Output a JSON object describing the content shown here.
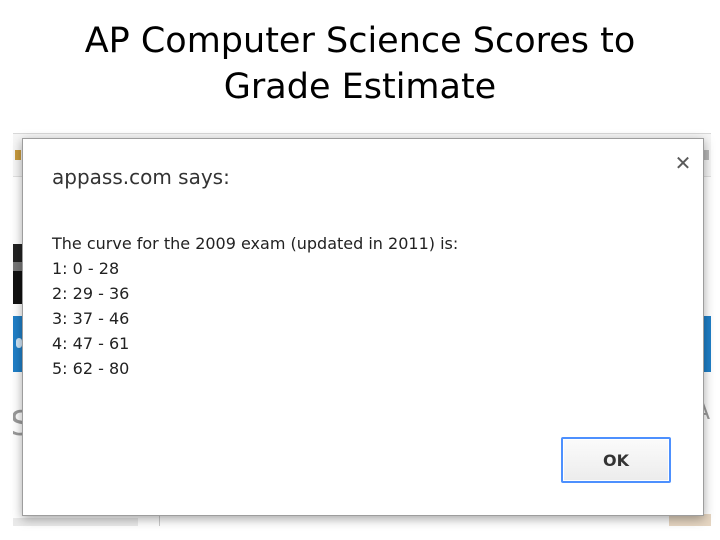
{
  "slide": {
    "title_line1": "AP Computer Science Scores to",
    "title_line2": "Grade Estimate"
  },
  "dialog": {
    "title": "appass.com says:",
    "close_icon": "close-icon",
    "message_lines": [
      "The curve for the 2009 exam (updated in 2011) is:",
      "1: 0 - 28",
      "2: 29 - 36",
      "3: 37 - 46",
      "4: 47 - 61",
      "5: 62 - 80"
    ],
    "ok_label": "OK",
    "focus_color": "#4d90fe"
  },
  "background": {
    "band_color": "#1f7fc7",
    "left_letter": "S",
    "right_letter": "A"
  }
}
